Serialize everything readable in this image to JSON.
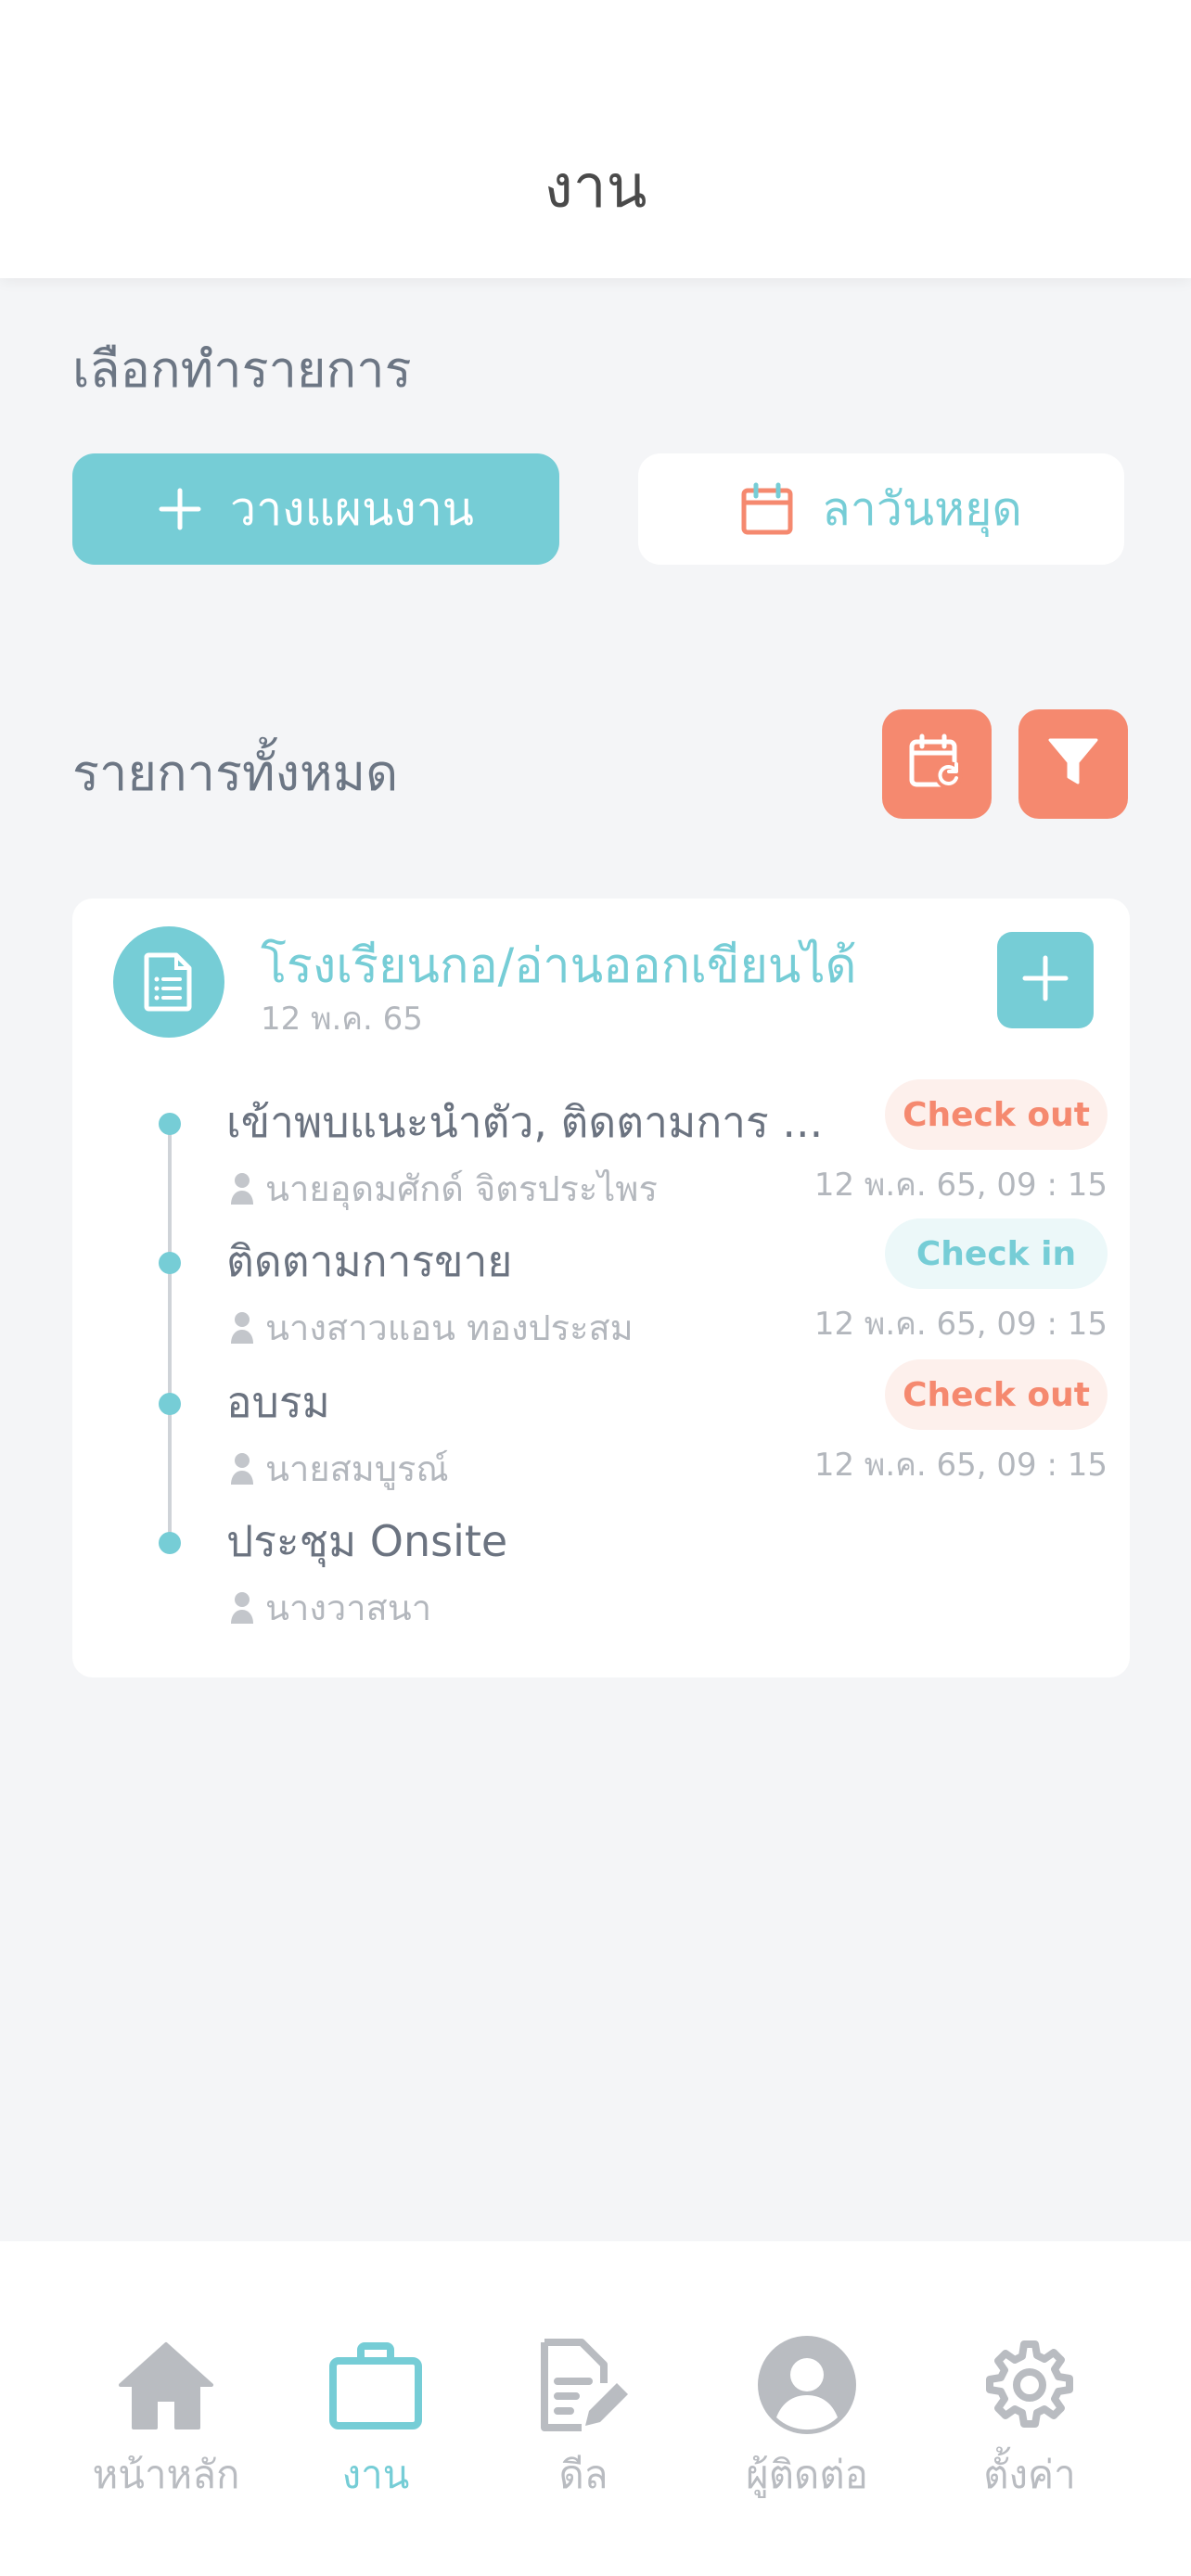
{
  "header": {
    "title": "งาน"
  },
  "actions": {
    "section_title": "เลือกทำรายการ",
    "plan_button": "วางแผนงาน",
    "leave_button": "ลาวันหยุด"
  },
  "list": {
    "section_title": "รายการทั้งหมด",
    "calendar_sync_icon": "calendar-refresh-icon",
    "filter_icon": "filter-icon"
  },
  "card": {
    "title": "โรงเรียนกอ/อ่านออกเขียนได้",
    "date": "12 พ.ค. 65",
    "items": [
      {
        "title": "เข้าพบแนะนำตัว, ติดตามการ ...",
        "person": "นายอุดมศักด์ จิตรประไพร",
        "status": "Check out",
        "time": "12 พ.ค. 65, 09 : 15"
      },
      {
        "title": "ติดตามการขาย",
        "person": "นางสาวแอน ทองประสม",
        "status": "Check in",
        "time": "12 พ.ค. 65, 09 : 15"
      },
      {
        "title": "อบรม",
        "person": "นายสมบูรณ์",
        "status": "Check out",
        "time": "12 พ.ค. 65, 09 : 15"
      },
      {
        "title": "ประชุม Onsite",
        "person": "นางวาสนา"
      }
    ]
  },
  "tabbar": {
    "tabs": [
      {
        "label": "หน้าหลัก",
        "icon": "home-icon",
        "active": false
      },
      {
        "label": "งาน",
        "icon": "briefcase-icon",
        "active": true
      },
      {
        "label": "ดีล",
        "icon": "document-edit-icon",
        "active": false
      },
      {
        "label": "ผู้ติดต่อ",
        "icon": "user-circle-icon",
        "active": false
      },
      {
        "label": "ตั้งค่า",
        "icon": "gear-icon",
        "active": false
      }
    ]
  },
  "colors": {
    "accent": "#76cdd6",
    "orange": "#f5896f",
    "background": "#f4f5f7",
    "muted": "#b3b7bd"
  }
}
